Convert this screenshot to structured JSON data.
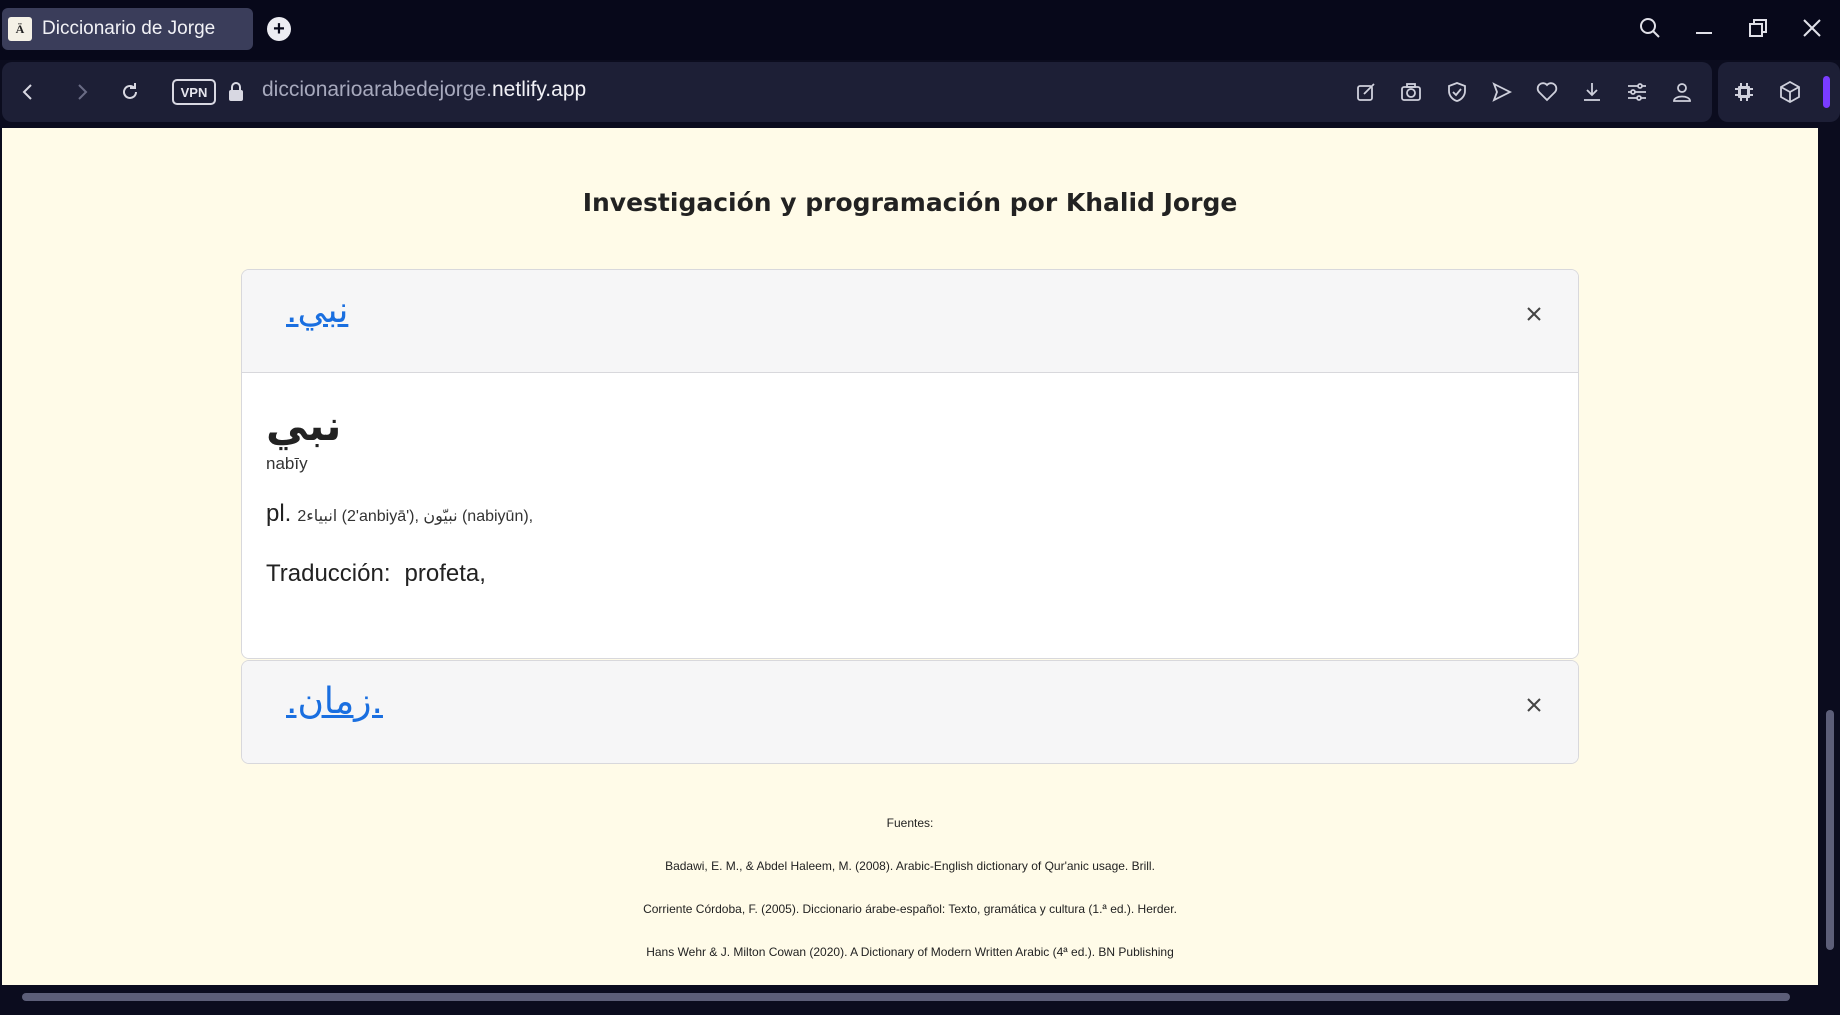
{
  "browser": {
    "tab": {
      "title": "Diccionario de Jorge",
      "favicon_glyph": "Ä"
    },
    "address": {
      "vpn_label": "VPN",
      "url_domain": "diccionarioarabedejorge.",
      "url_host": "netlify.app"
    }
  },
  "page": {
    "title": "Investigación y programación por Khalid Jorge",
    "entries": [
      {
        "link": "نبي.",
        "word": "نبي",
        "transliteration": "nabīy",
        "plural_label": "pl.",
        "plurals": "2انبياء (2'anbiyā'),   نبيّون (nabiyūn),",
        "translation_label": "Traducción:",
        "translation": "profeta,"
      },
      {
        "link": ".زمان."
      }
    ],
    "sources": [
      "Fuentes:",
      "Badawi, E. M., & Abdel Haleem, M. (2008). Arabic-English dictionary of Qur'anic usage. Brill.",
      "Corriente Córdoba, F. (2005). Diccionario árabe-español: Texto, gramática y cultura (1.ª ed.). Herder.",
      "Hans Wehr & J. Milton Cowan (2020). A Dictionary of Modern Written Arabic (4ª ed.). BN Publishing"
    ]
  },
  "colors": {
    "page_bg": "#fffbe8",
    "link": "#1a6fe0",
    "chrome_bg": "#07081a",
    "accent": "#7a3cff"
  }
}
